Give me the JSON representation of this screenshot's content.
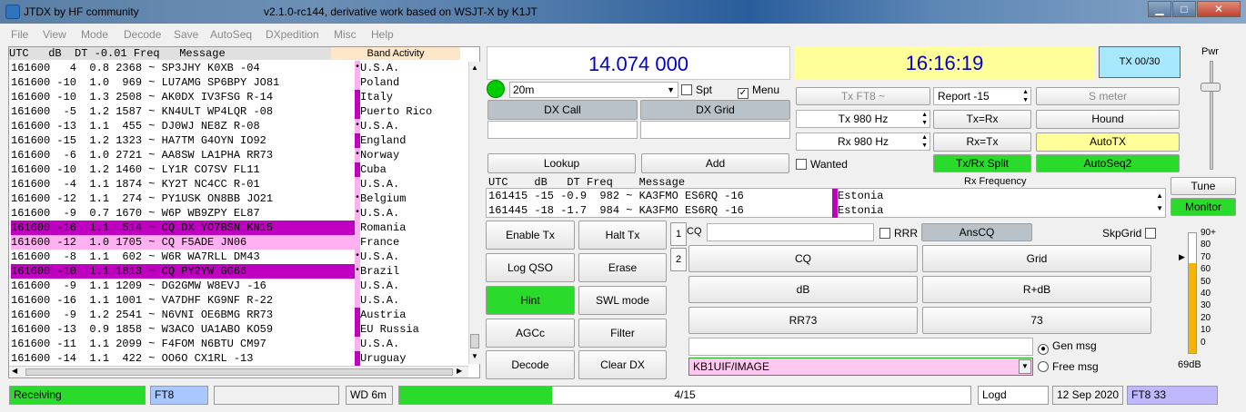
{
  "window": {
    "app_title": "JTDX  by HF community",
    "subtitle": "v2.1.0-rc144, derivative work based on WSJT-X by K1JT",
    "minimize": "▁",
    "maximize": "□",
    "close": "✕"
  },
  "menu": [
    "File",
    "View",
    "Mode",
    "Decode",
    "Save",
    "AutoSeq",
    "DXpedition",
    "Misc",
    "Help"
  ],
  "decodes": {
    "header": "UTC   dB  DT -0.01 Freq   Message",
    "band_header": "Band Activity",
    "rows": [
      {
        "text": "161600   4  0.8 2368 ~ SP3JHY K0XB -04",
        "country": "U.S.A.",
        "mark": "dot",
        "hl": ""
      },
      {
        "text": "161600 -10  1.0  969 ~ LU7AMG SP6BPY JO81",
        "country": "Poland",
        "mark": "",
        "hl": ""
      },
      {
        "text": "161600 -10  1.3 2508 ~ AK0DX IV3FSG R-14",
        "country": "Italy",
        "mark": "bar",
        "hl": ""
      },
      {
        "text": "161600  -5  1.2 1587 ~ KN4ULT WP4LQR -08",
        "country": "Puerto Rico",
        "mark": "bar",
        "hl": ""
      },
      {
        "text": "161600 -13  1.1  455 ~ DJ0WJ NE8Z R-08",
        "country": "U.S.A.",
        "mark": "dot",
        "hl": ""
      },
      {
        "text": "161600 -15  1.2 1323 ~ HA7TM G4OYN IO92",
        "country": "England",
        "mark": "bar",
        "hl": ""
      },
      {
        "text": "161600  -6  1.0 2721 ~ AA8SW LA1PHA RR73",
        "country": "Norway",
        "mark": "dot",
        "hl": ""
      },
      {
        "text": "161600 -10  1.2 1460 ~ LY1R CO7SV FL11",
        "country": "Cuba",
        "mark": "bar",
        "hl": ""
      },
      {
        "text": "161600  -4  1.1 1874 ~ KY2T NC4CC R-01",
        "country": "U.S.A.",
        "mark": "",
        "hl": ""
      },
      {
        "text": "161600 -12  1.1  274 ~ PY1USK ON8BB JO21",
        "country": "Belgium",
        "mark": "dot",
        "hl": ""
      },
      {
        "text": "161600  -9  0.7 1670 ~ W6P WB9ZPY EL87",
        "country": "U.S.A.",
        "mark": "dot",
        "hl": ""
      },
      {
        "text": "161600 -16  1.1  514 ~ CQ DX YO7BSN KN15",
        "country": "Romania",
        "mark": "",
        "hl": "cq1"
      },
      {
        "text": "161600 -12  1.0 1705 ~ CQ F5ADE JN06",
        "country": "France",
        "mark": "",
        "hl": "cq2"
      },
      {
        "text": "161600  -8  1.1  602 ~ W6R WA7RLL DM43",
        "country": "U.S.A.",
        "mark": "dot",
        "hl": ""
      },
      {
        "text": "161600 -10  1.1 1813 ~ CQ PY2YW GG66",
        "country": "Brazil",
        "mark": "dot",
        "hl": "cq1"
      },
      {
        "text": "161600  -9  1.1 1209 ~ DG2GMW W8EVJ -16",
        "country": "U.S.A.",
        "mark": "",
        "hl": ""
      },
      {
        "text": "161600 -16  1.1 1001 ~ VA7DHF KG9NF R-22",
        "country": "U.S.A.",
        "mark": "",
        "hl": ""
      },
      {
        "text": "161600  -9  1.2 2541 ~ N6VNI OE6BMG RR73",
        "country": "Austria",
        "mark": "bar",
        "hl": ""
      },
      {
        "text": "161600 -13  0.9 1858 ~ W3ACO UA1ABO KO59",
        "country": "EU Russia",
        "mark": "bar",
        "hl": ""
      },
      {
        "text": "161600 -11  1.1 2099 ~ F4FOM N6BTU CM97",
        "country": "U.S.A.",
        "mark": "",
        "hl": ""
      },
      {
        "text": "161600 -14  1.1  422 ~ OO6O CX1RL -13",
        "country": "Uruguay",
        "mark": "bar",
        "hl": ""
      }
    ]
  },
  "frequency": "14.074 000",
  "clock": "16:16:19",
  "tx_count": "TX 00/30",
  "band": "20m",
  "spot_label": "Spt",
  "menu_label": "Menu",
  "dx_call_label": "DX Call",
  "dx_grid_label": "DX Grid",
  "lookup": "Lookup",
  "add": "Add",
  "tx_mode": "Tx FT8 ~",
  "report": "Report -15",
  "s_meter": "S meter",
  "tx_hz": "Tx  980  Hz",
  "rx_hz": "Rx  980  Hz",
  "tx_eq_rx": "Tx=Rx",
  "rx_eq_tx": "Rx=Tx",
  "hound": "Hound",
  "autotx": "AutoTX",
  "wanted": "Wanted",
  "split": "Tx/Rx Split",
  "autoseq2": "AutoSeq2",
  "rx_freq_label": "Rx Frequency",
  "rx": {
    "header": "UTC    dB   DT Freq    Message",
    "rows": [
      {
        "text": "161415 -15 -0.9  982 ~ KA3FMO ES6RQ -16",
        "country": "Estonia"
      },
      {
        "text": "161445 -18 -1.7  984 ~ KA3FMO ES6RQ -16",
        "country": "Estonia"
      }
    ]
  },
  "pwr": "Pwr",
  "tune": "Tune",
  "monitor": "Monitor",
  "buttons": {
    "enable_tx": "Enable Tx",
    "halt_tx": "Halt Tx",
    "log_qso": "Log QSO",
    "erase": "Erase",
    "hint": "Hint",
    "swl": "SWL mode",
    "agcc": "AGCc",
    "filter": "Filter",
    "decode": "Decode",
    "clear_dx": "Clear DX"
  },
  "tabs": [
    "1",
    "2"
  ],
  "cq_label": "CQ",
  "rrr": "RRR",
  "anscq": "AnsCQ",
  "skpgrid": "SkpGrid",
  "msg_buttons": [
    "CQ",
    "Grid",
    "dB",
    "R+dB",
    "RR73",
    "73"
  ],
  "gen_msg": "Gen msg",
  "free_msg": "Free msg",
  "free_text": "KB1UIF/IMAGE",
  "meter": {
    "ticks": [
      "90+",
      "80",
      "70",
      "60",
      "50",
      "40",
      "30",
      "20",
      "10",
      "0"
    ],
    "db": "69dB",
    "level": 0.75
  },
  "status": {
    "receiving": "Receiving",
    "mode": "FT8",
    "wd": "WD 6m",
    "progress": "4/15",
    "progress_frac": 0.267,
    "logd": "Logd",
    "date": "12 Sep 2020",
    "right": "FT8  33"
  },
  "colors": {
    "green": "#2bdb2b",
    "yellow": "#ffff99",
    "magenta": "#c000c0",
    "pink": "#ffb0f0",
    "freq": "#0000c8"
  }
}
